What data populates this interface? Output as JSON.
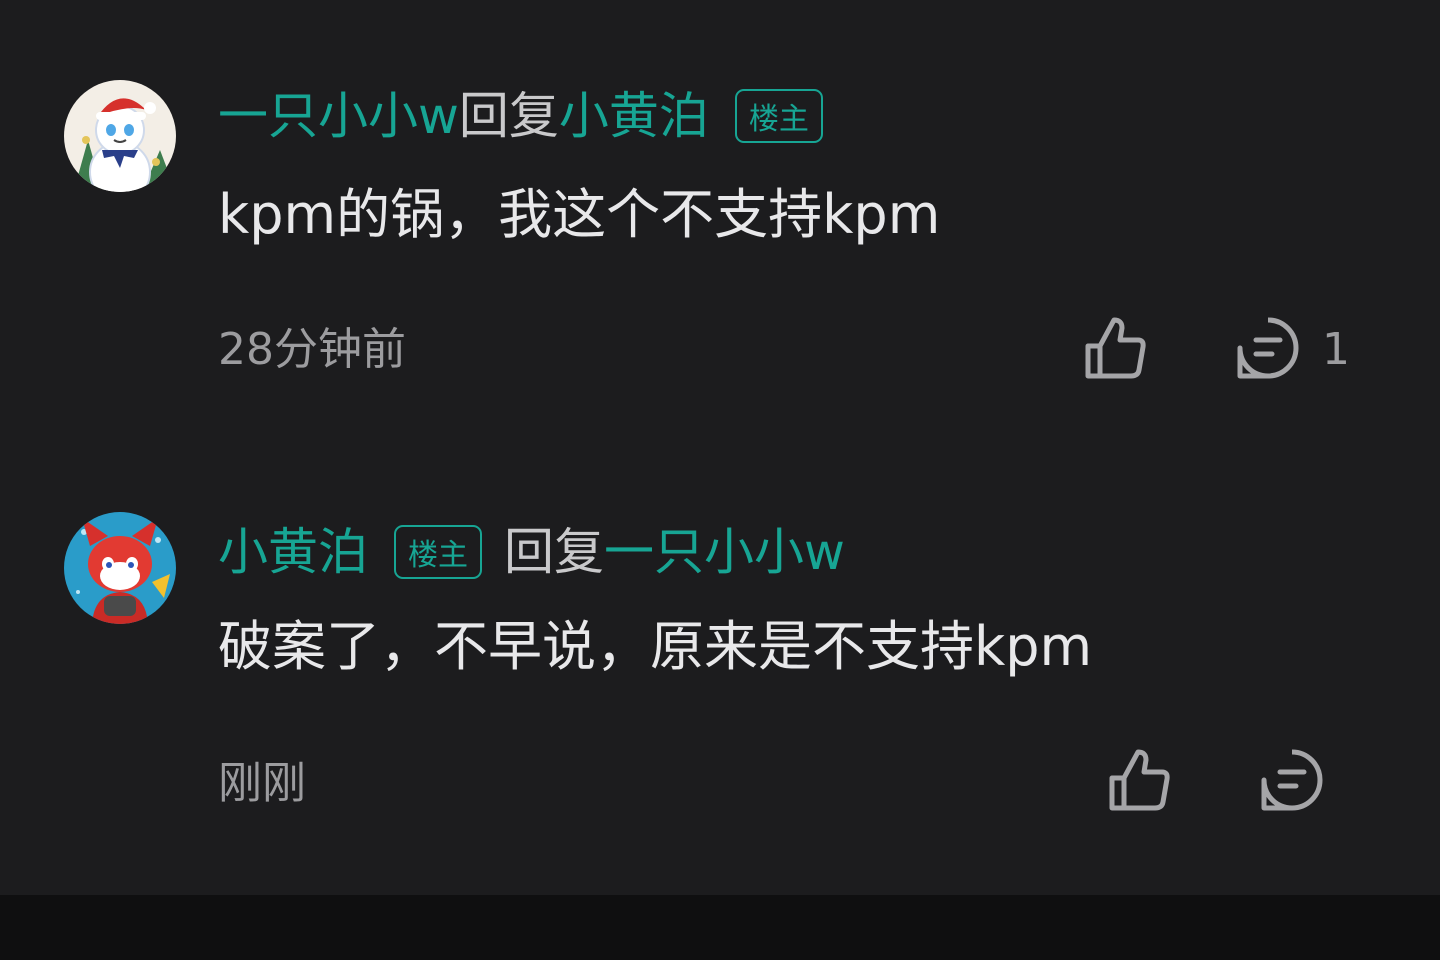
{
  "comments": [
    {
      "author": "一只小小w",
      "reply_word": "回复",
      "reply_to": "小黄泊",
      "badge": "楼主",
      "badge_on": "reply_to",
      "text": "kpm的锅，我这个不支持kpm",
      "time": "28分钟前",
      "reply_count": "1",
      "avatar_icon": "snowman-avatar-icon"
    },
    {
      "author": "小黄泊",
      "badge": "楼主",
      "badge_on": "author",
      "reply_word": "回复",
      "reply_to": "一只小小w",
      "text": "破案了，不早说，原来是不支持kpm",
      "time": "刚刚",
      "reply_count": "",
      "avatar_icon": "red-fox-avatar-icon"
    }
  ],
  "colors": {
    "background": "#1c1c1e",
    "accent": "#17a594",
    "text_primary": "#e8e8ea",
    "text_secondary": "#9c9c9f"
  },
  "icons": {
    "like": "thumbs-up-icon",
    "reply": "comment-bubble-icon"
  }
}
